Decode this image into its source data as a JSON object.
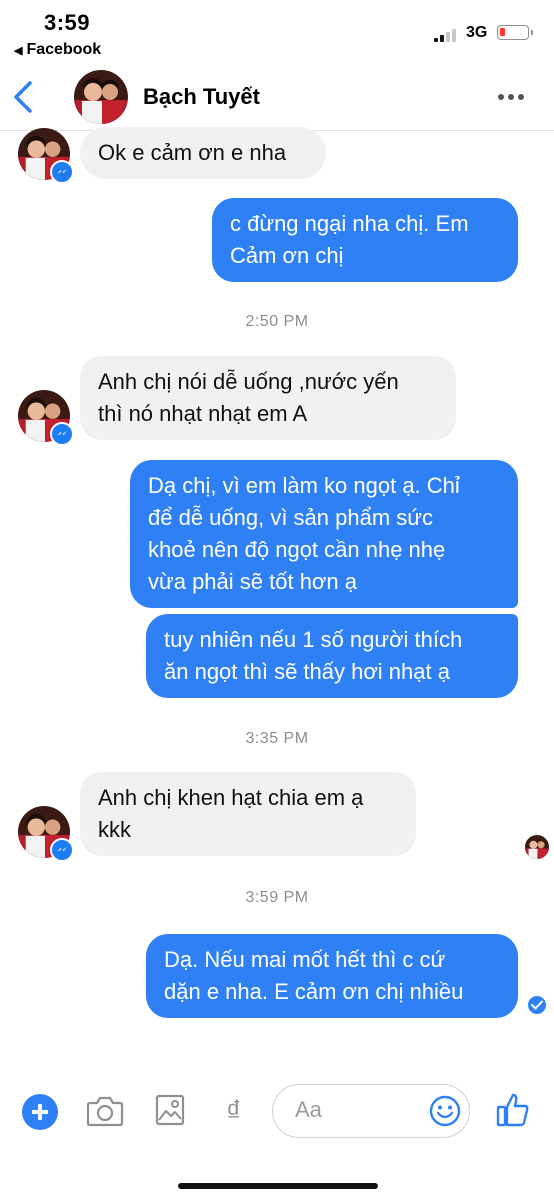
{
  "status_bar": {
    "time": "3:59",
    "back_app": "Facebook",
    "network": "3G"
  },
  "header": {
    "contact_name": "Bạch Tuyết"
  },
  "conversation": {
    "messages": [
      {
        "sender": "contact",
        "text": "Ok e cảm ơn e nha"
      },
      {
        "sender": "me",
        "lines": [
          "c đừng ngại nha chị. Em",
          "Cảm ơn chị"
        ]
      },
      {
        "sender": "contact",
        "lines": [
          "Anh chị nói dễ uống ,nước yến",
          "thì nó nhạt nhạt em A"
        ]
      },
      {
        "sender": "me",
        "lines": [
          "Dạ chị, vì em làm ko ngọt ạ. Chỉ",
          "để dễ uống, vì sản phẩm sức",
          "khoẻ nên độ ngọt cần nhẹ nhẹ",
          "vừa phải sẽ tốt hơn ạ"
        ]
      },
      {
        "sender": "me",
        "lines": [
          "tuy nhiên nếu 1 số người thích",
          "ăn ngọt thì sẽ thấy hơi nhạt ạ"
        ]
      },
      {
        "sender": "contact",
        "lines": [
          "Anh chị khen hạt chia em ạ",
          "kkk"
        ]
      },
      {
        "sender": "me",
        "lines": [
          "Dạ. Nếu mai mốt hết thì c cứ",
          "dặn e nha. E cảm ơn chị nhiều"
        ]
      }
    ],
    "timestamps": [
      "2:50 PM",
      "3:35 PM",
      "3:59 PM"
    ]
  },
  "composer": {
    "placeholder": "Aa",
    "currency_symbol": "₫"
  },
  "colors": {
    "accent": "#2f80f5",
    "incoming_bubble": "#f1f1f2",
    "timestamp": "#8e8e93",
    "battery_low": "#ff3b30"
  },
  "icons": [
    "back-chevron-icon",
    "more-options-icon",
    "messenger-badge-icon",
    "plus-icon",
    "camera-icon",
    "gallery-icon",
    "currency-icon",
    "emoji-icon",
    "thumbs-up-icon",
    "delivered-check-icon"
  ]
}
